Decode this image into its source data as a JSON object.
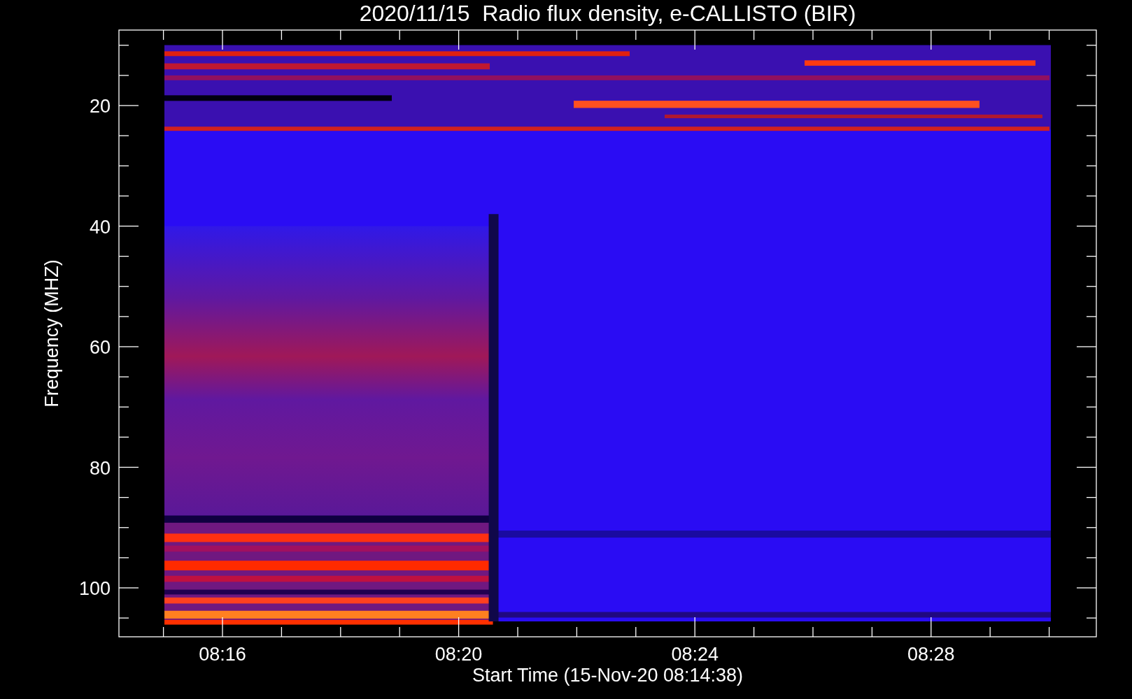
{
  "plot": {
    "title": "2020/11/15  Radio flux density, e-CALLISTO (BIR)",
    "xlabel": "Start Time (15-Nov-20 08:14:38)",
    "ylabel": "Frequency (MHZ)",
    "xticks": [
      {
        "label": "08:16"
      },
      {
        "label": "08:20"
      },
      {
        "label": "08:24"
      },
      {
        "label": "08:28"
      }
    ],
    "yticks": [
      {
        "label": "20"
      },
      {
        "label": "40"
      },
      {
        "label": "60"
      },
      {
        "label": "80"
      },
      {
        "label": "100"
      }
    ]
  }
}
